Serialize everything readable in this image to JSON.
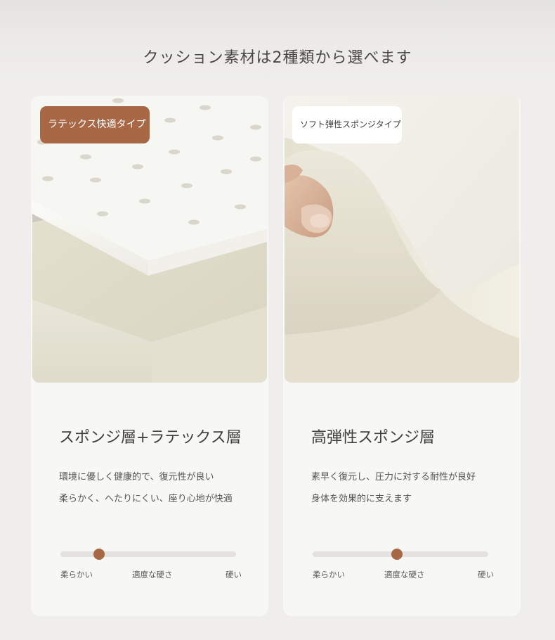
{
  "page": {
    "title": "クッション素材は2種類から選べます"
  },
  "cards": [
    {
      "tag": "ラテックス快適タイプ",
      "heading": "スポンジ層+ラテックス層",
      "description": [
        "環境に優しく健康的で、復元性が良い",
        "柔らかく、へたりにくい、座り心地が快適"
      ],
      "scale": {
        "labels": [
          "柔らかい",
          "適度な硬さ",
          "硬い"
        ],
        "level": 0.22
      }
    },
    {
      "tag": "ソフト弾性スポンジタイプ",
      "heading": "高弾性スポンジ層",
      "description": [
        "素早く復元し、圧力に対する耐性が良好",
        "身体を効果的に支えます"
      ],
      "scale": {
        "labels": [
          "柔らかい",
          "適度な硬さ",
          "硬い"
        ],
        "level": 0.48
      }
    }
  ],
  "colors": {
    "accent": "#a96845",
    "background": "#efeeec",
    "card": "#f7f7f6"
  }
}
